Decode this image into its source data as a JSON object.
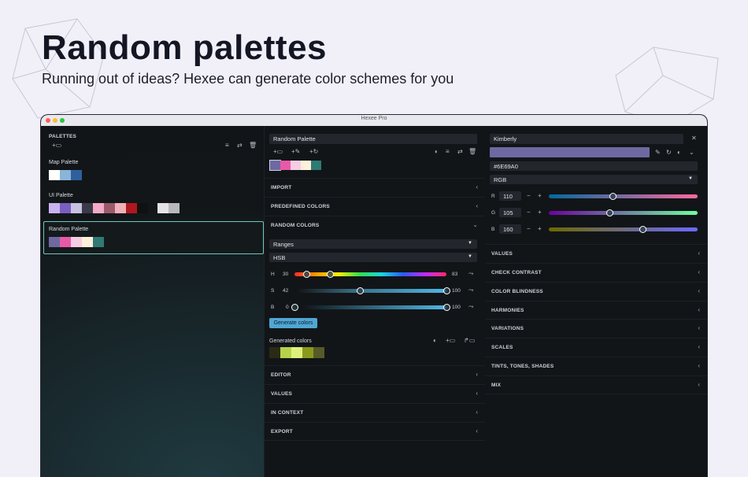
{
  "hero": {
    "title": "Random palettes",
    "subtitle": "Running out of ideas? Hexee can generate color schemes for you"
  },
  "window": {
    "title": "Hexee Pro"
  },
  "left": {
    "header": "PALETTES",
    "palettes": [
      {
        "name": "Map Palette",
        "colors": [
          "#ffffff",
          "#8ab4d8",
          "#2f5f9c"
        ]
      },
      {
        "name": "UI Palette",
        "colors": [
          "#c9b2f0",
          "#7a5ec0",
          "#c8c0e0",
          "#3a3a48",
          "#f3aac8",
          "#9b5a6a",
          "#f3b0b8",
          "#b0171e",
          "#111111",
          "#e4e4e8",
          "#b8b8be"
        ]
      },
      {
        "name": "Random Palette",
        "colors": [
          "#6e69a0",
          "#e85aa8",
          "#f6cde3",
          "#fff0da",
          "#2f7a74"
        ],
        "selected": true
      }
    ]
  },
  "mid": {
    "palette_name": "Random Palette",
    "swatches": [
      "#6e69a0",
      "#e85aa8",
      "#f6cde3",
      "#fff0da",
      "#2f7a74"
    ],
    "sections_top": [
      "IMPORT",
      "PREDEFINED COLORS"
    ],
    "random_header": "RANDOM COLORS",
    "mode_select": "Ranges",
    "space_select": "HSB",
    "h": {
      "label": "H",
      "min": "30",
      "max": "83"
    },
    "s": {
      "label": "S",
      "min": "42",
      "max": "100"
    },
    "b": {
      "label": "B",
      "min": "0",
      "max": "100"
    },
    "generate_label": "Generate colors",
    "generated_label": "Generated colors",
    "generated": [
      "#2b2a14",
      "#b6d24a",
      "#dff07a",
      "#8a9a1c",
      "#555a28"
    ],
    "sections_bottom": [
      "EDITOR",
      "VALUES",
      "IN CONTEXT",
      "EXPORT"
    ]
  },
  "right": {
    "color_name": "Kimberly",
    "color": "#6e69a0",
    "hex": "#6E69A0",
    "mode": "RGB",
    "r": {
      "label": "R",
      "value": "110",
      "fraction": 0.43
    },
    "g": {
      "label": "G",
      "value": "105",
      "fraction": 0.41
    },
    "b": {
      "label": "B",
      "value": "160",
      "fraction": 0.63
    },
    "sections": [
      "VALUES",
      "CHECK CONTRAST",
      "COLOR BLINDNESS",
      "HARMONIES",
      "VARIATIONS",
      "SCALES",
      "TINTS, TONES, SHADES",
      "MIX"
    ]
  }
}
